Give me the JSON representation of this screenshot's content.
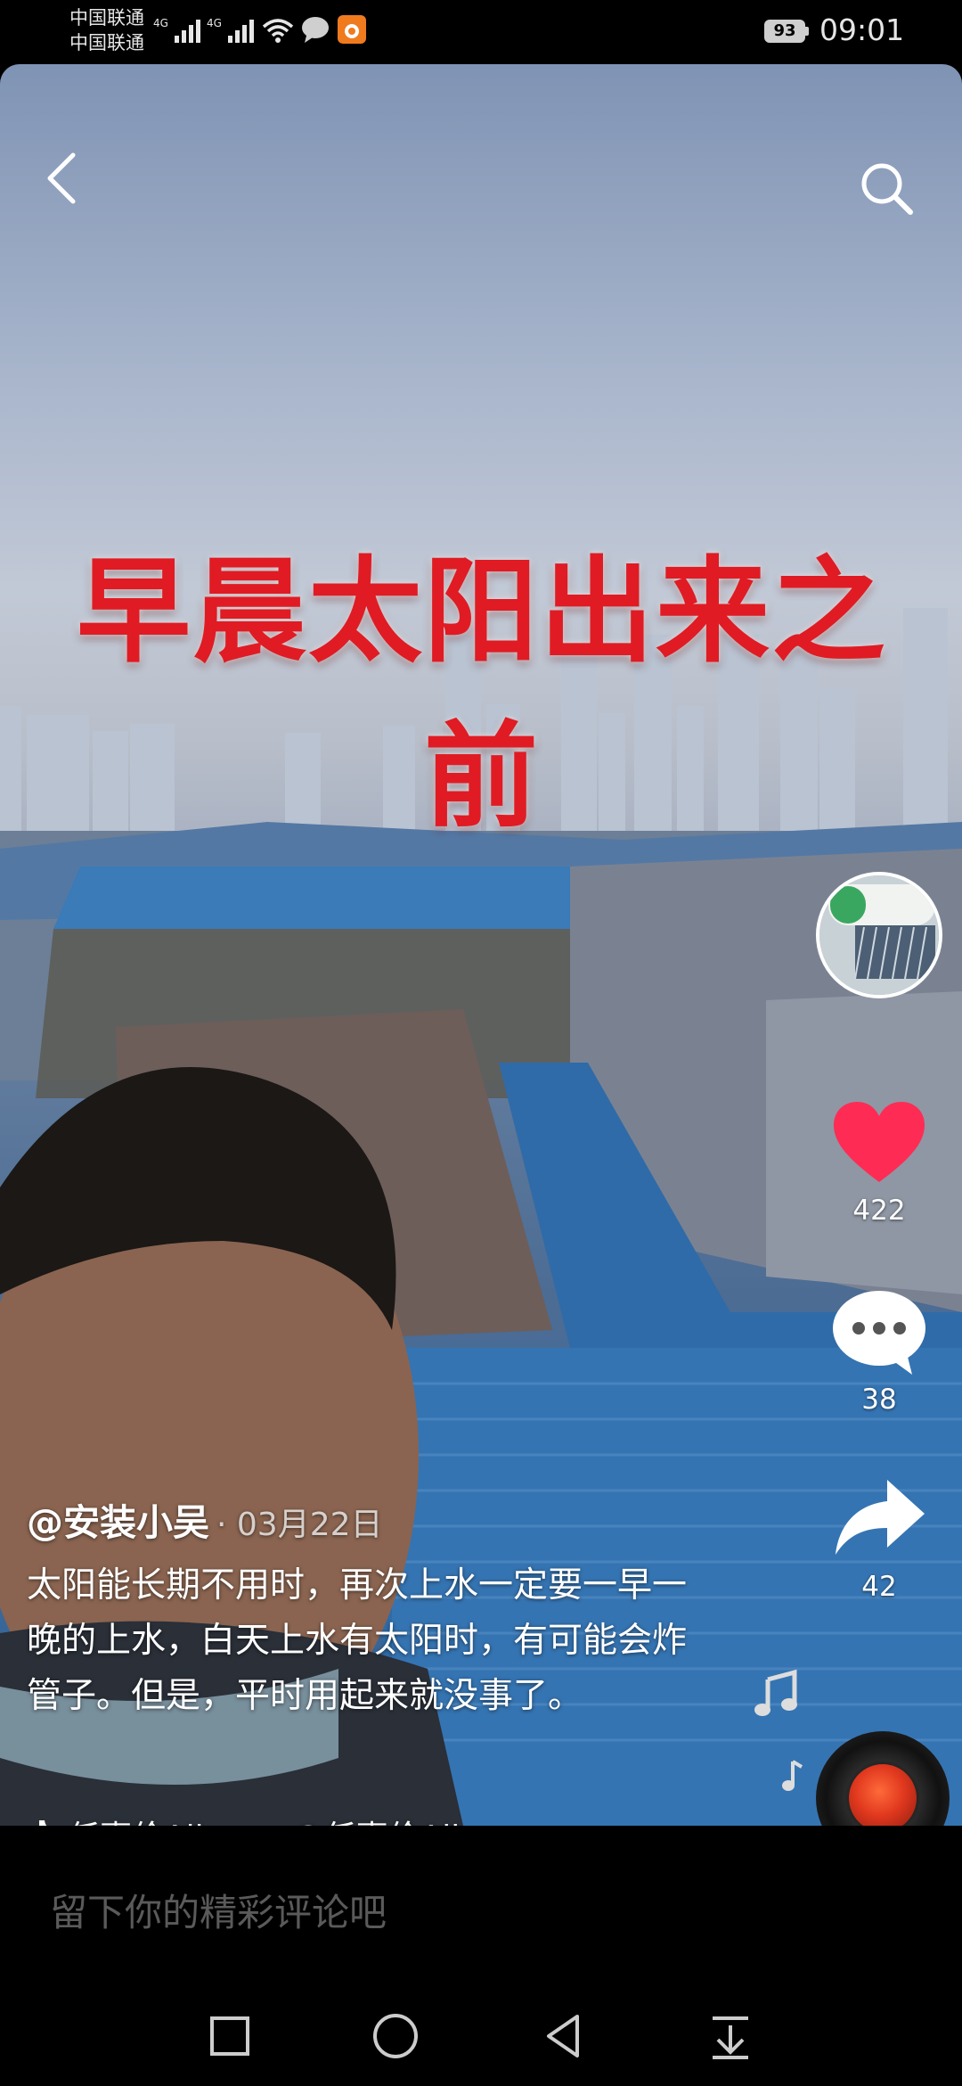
{
  "status_bar": {
    "carrier_1": "中国联通",
    "carrier_2": "中国联通",
    "battery": "93",
    "time": "09:01"
  },
  "video": {
    "overlay_title": "早晨太阳出来之前"
  },
  "actions": {
    "likes": "422",
    "comments": "38",
    "shares": "42"
  },
  "post": {
    "author": "@安装小吴",
    "date": "· 03月22日",
    "caption": "太阳能长期不用时，再次上水一定要一早一晚的上水，白天上水有太阳时，有可能会炸管子。但是，平时用起来就没事了。",
    "music_title": "任嘉伦Allen",
    "music_author": "@任嘉伦Allen"
  },
  "comment_bar": {
    "placeholder": "留下你的精彩评论吧"
  },
  "icons": {
    "back": "back-arrow-icon",
    "search": "search-icon",
    "like": "heart-icon",
    "comment": "comment-bubble-icon",
    "share": "share-arrow-icon",
    "music": "music-note-icon",
    "tiktok": "tiktok-logo-icon",
    "nav_recent": "square-icon",
    "nav_home": "circle-icon",
    "nav_back": "triangle-back-icon",
    "nav_notifications": "pull-down-icon"
  },
  "colors": {
    "like": "#fe2c55",
    "overlay_title": "#e01b24"
  }
}
